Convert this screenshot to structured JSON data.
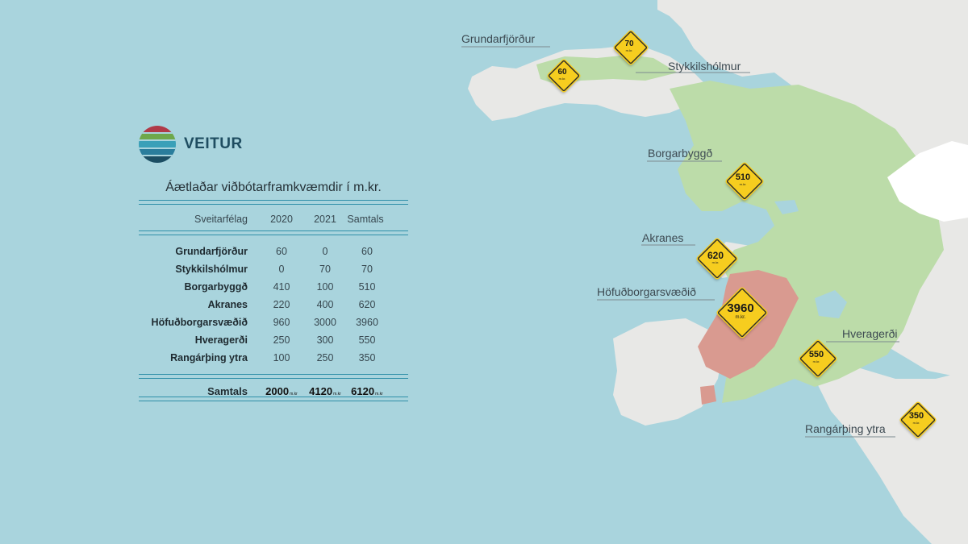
{
  "brand": {
    "name": "VEITUR",
    "stripes": [
      "#b03a48",
      "#6ea84b",
      "#3aa0b8",
      "#2a7d9c",
      "#1c4e63"
    ]
  },
  "colors": {
    "sea": "#a9d4dd",
    "land": "#e8e8e6",
    "region": "#bcdca9",
    "capital": "#d99a90",
    "sign": "#f6cd1f"
  },
  "table": {
    "title": "Áætlaðar viðbótarframkvæmdir í m.kr.",
    "headers": {
      "name": "Sveitarfélag",
      "y2020": "2020",
      "y2021": "2021",
      "total": "Samtals"
    },
    "rows": [
      {
        "name": "Grundarfjörður",
        "y2020": "60",
        "y2021": "0",
        "total": "60"
      },
      {
        "name": "Stykkilshólmur",
        "y2020": "0",
        "y2021": "70",
        "total": "70"
      },
      {
        "name": "Borgarbyggð",
        "y2020": "410",
        "y2021": "100",
        "total": "510"
      },
      {
        "name": "Akranes",
        "y2020": "220",
        "y2021": "400",
        "total": "620"
      },
      {
        "name": "Höfuðborgarsvæðið",
        "y2020": "960",
        "y2021": "3000",
        "total": "3960"
      },
      {
        "name": "Hveragerði",
        "y2020": "250",
        "y2021": "300",
        "total": "550"
      },
      {
        "name": "Rangárþing ytra",
        "y2020": "100",
        "y2021": "250",
        "total": "350"
      }
    ],
    "totals": {
      "name": "Samtals",
      "y2020": "2000",
      "y2021": "4120",
      "total": "6120",
      "unit": "m.kr"
    }
  },
  "map": {
    "unit": "m.kr.",
    "markers": [
      {
        "name": "Grundarfjörður",
        "value": "60"
      },
      {
        "name": "Stykkilshólmur",
        "value": "70"
      },
      {
        "name": "Borgarbyggð",
        "value": "510"
      },
      {
        "name": "Akranes",
        "value": "620"
      },
      {
        "name": "Höfuðborgarsvæðið",
        "value": "3960"
      },
      {
        "name": "Hveragerði",
        "value": "550"
      },
      {
        "name": "Rangárþing ytra",
        "value": "350"
      }
    ]
  }
}
